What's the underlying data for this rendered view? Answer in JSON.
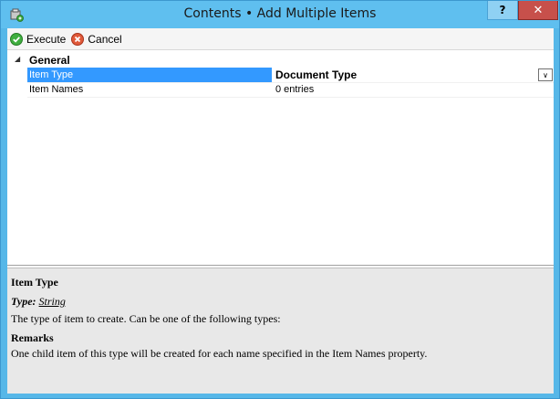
{
  "window": {
    "title": "Contents • Add Multiple Items",
    "help_label": "?",
    "close_label": "✕"
  },
  "toolbar": {
    "execute_label": "Execute",
    "cancel_label": "Cancel"
  },
  "grid": {
    "category": "General",
    "rows": [
      {
        "name": "Item Type",
        "value": "Document Type",
        "selected": true
      },
      {
        "name": "Item Names",
        "value": "0 entries",
        "selected": false
      }
    ]
  },
  "description": {
    "title": "Item Type",
    "type_prefix": "Type:",
    "type_value": "String",
    "text": "The type of item to create. Can be one of the following types:",
    "remarks_heading": "Remarks",
    "remarks_text": "One child item of this type will be created for each name specified in the Item Names property."
  },
  "colors": {
    "titlebar": "#5fbfef",
    "selection": "#3399ff",
    "close": "#c7504b"
  }
}
